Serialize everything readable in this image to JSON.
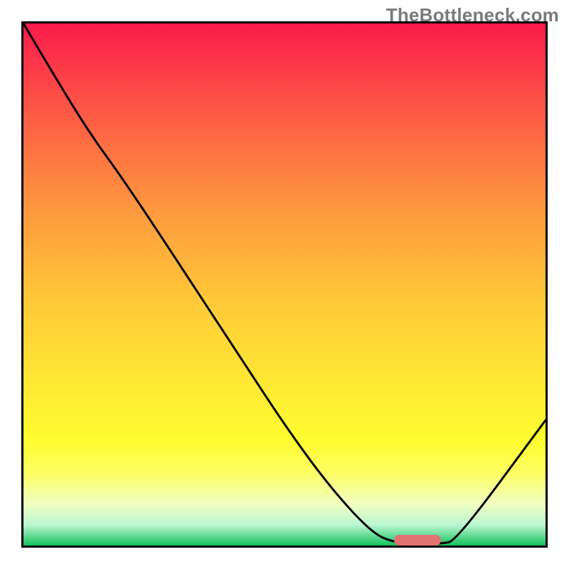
{
  "watermark": "TheBottleneck.com",
  "chart_data": {
    "type": "line",
    "title": "",
    "xlabel": "",
    "ylabel": "",
    "xlim": [
      0,
      100
    ],
    "ylim": [
      0,
      100
    ],
    "gradient_stops": [
      {
        "pct": 0,
        "color": "#fb1b4b"
      },
      {
        "pct": 7,
        "color": "#fc3449"
      },
      {
        "pct": 15,
        "color": "#fd5246"
      },
      {
        "pct": 25,
        "color": "#fe7542"
      },
      {
        "pct": 35,
        "color": "#fe963f"
      },
      {
        "pct": 45,
        "color": "#ffb23b"
      },
      {
        "pct": 53,
        "color": "#ffc838"
      },
      {
        "pct": 62,
        "color": "#ffdb35"
      },
      {
        "pct": 72,
        "color": "#ffee32"
      },
      {
        "pct": 80,
        "color": "#fffd30"
      },
      {
        "pct": 86,
        "color": "#fdfe62"
      },
      {
        "pct": 92,
        "color": "#f1fec0"
      },
      {
        "pct": 96,
        "color": "#bdf7d2"
      },
      {
        "pct": 99,
        "color": "#3ecf7a"
      },
      {
        "pct": 100,
        "color": "#14c35f"
      }
    ],
    "series": [
      {
        "name": "curve",
        "points": [
          {
            "x": 0.0,
            "y": 100.0
          },
          {
            "x": 6.5,
            "y": 89.0
          },
          {
            "x": 13.0,
            "y": 78.5
          },
          {
            "x": 20.0,
            "y": 68.9
          },
          {
            "x": 37.0,
            "y": 43.0
          },
          {
            "x": 54.0,
            "y": 17.0
          },
          {
            "x": 66.0,
            "y": 2.8
          },
          {
            "x": 71.5,
            "y": 0.3
          },
          {
            "x": 80.0,
            "y": 0.3
          },
          {
            "x": 83.0,
            "y": 1.0
          },
          {
            "x": 100.0,
            "y": 24.0
          }
        ]
      }
    ],
    "marker": {
      "x_start": 71.0,
      "x_end": 80.0,
      "y": 1.1
    }
  }
}
